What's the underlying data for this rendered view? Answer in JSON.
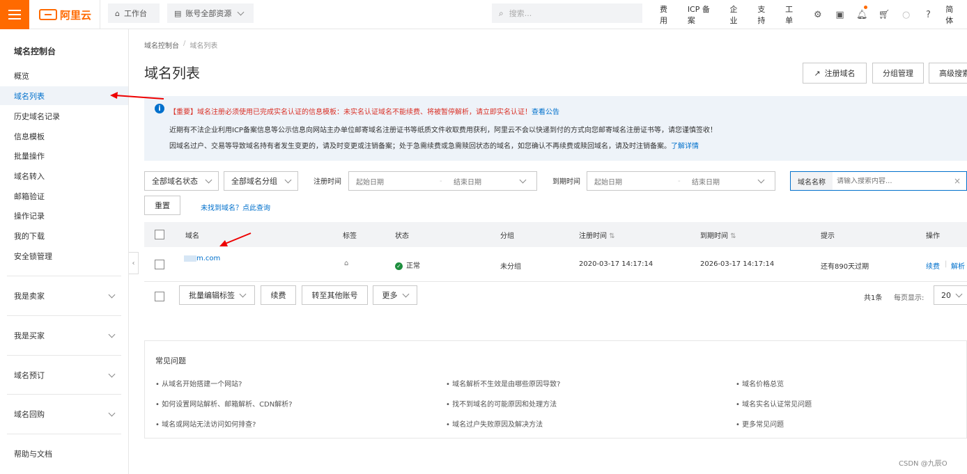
{
  "topbar": {
    "logo_text": "阿里云",
    "workbench": "工作台",
    "resources": "账号全部资源",
    "search_placeholder": "搜索...",
    "links": [
      "费用",
      "ICP 备案",
      "企业",
      "支持",
      "工单"
    ],
    "lang": "简体"
  },
  "sidebar": {
    "title": "域名控制台",
    "items": [
      "概览",
      "域名列表",
      "历史域名记录",
      "信息模板",
      "批量操作",
      "域名转入",
      "邮箱验证",
      "操作记录",
      "我的下载",
      "安全锁管理"
    ],
    "active_index": 1,
    "groups": [
      "我是卖家",
      "我是买家",
      "域名预订",
      "域名回购"
    ],
    "help": "帮助与文档"
  },
  "main": {
    "breadcrumb": [
      "域名控制台",
      "域名列表"
    ],
    "title": "域名列表",
    "header_buttons": {
      "register": "注册域名",
      "group": "分组管理",
      "advanced": "高级搜索"
    },
    "notice": {
      "line1_red": "【重要】域名注册必须使用已完成实名认证的信息模板：未实名认证域名不能续费、将被暂停解析，请立即实名认证！",
      "line1_link": "查看公告",
      "line2": "近期有不法企业利用ICP备案信息等公示信息向网站主办单位邮寄域名注册证书等纸质文件收取费用获利，阿里云不会以快递到付的方式向您邮寄域名注册证书等，请您谨慎签收！",
      "line3": "因域名过户、交易等导致域名持有者发生变更的，请及时变更或注销备案；处于急需续费或急需赎回状态的域名，如您确认不再续费或赎回域名，请及时注销备案。",
      "line3_link": "了解详情"
    },
    "filters": {
      "status": "全部域名状态",
      "group": "全部域名分组",
      "reg_label": "注册时间",
      "exp_label": "到期时间",
      "start": "起始日期",
      "end": "结束日期",
      "search_label": "域名名称",
      "search_placeholder": "请输入搜索内容..."
    },
    "reset": "重置",
    "not_found": "未找到域名？点此查询",
    "table": {
      "headers": [
        "域名",
        "标签",
        "状态",
        "分组",
        "注册时间",
        "到期时间",
        "提示",
        "操作"
      ],
      "row": {
        "domain": "m.com",
        "status": "正常",
        "group": "未分组",
        "registered": "2020-03-17 14:17:14",
        "expires": "2026-03-17 14:17:14",
        "hint": "还有890天过期",
        "action1": "续费",
        "action2": "解析"
      }
    },
    "bulk": {
      "tags": "批量编辑标签",
      "renew": "续费",
      "transfer": "转至其他账号",
      "more": "更多",
      "total": "共1条",
      "per_page_label": "每页显示:",
      "per_page": "20"
    },
    "faq": {
      "title": "常见问题",
      "col1": [
        "• 从域名开始搭建一个网站?",
        "• 如何设置网站解析、邮箱解析、CDN解析?",
        "• 域名或网站无法访问如何排查?"
      ],
      "col2": [
        "• 域名解析不生效是由哪些原因导致?",
        "• 找不到域名的可能原因和处理方法",
        "• 域名过户失败原因及解决方法"
      ],
      "col3": [
        "• 域名价格总览",
        "• 域名实名认证常见问题",
        "• 更多常见问题"
      ]
    }
  },
  "watermark": "CSDN @九辰O"
}
